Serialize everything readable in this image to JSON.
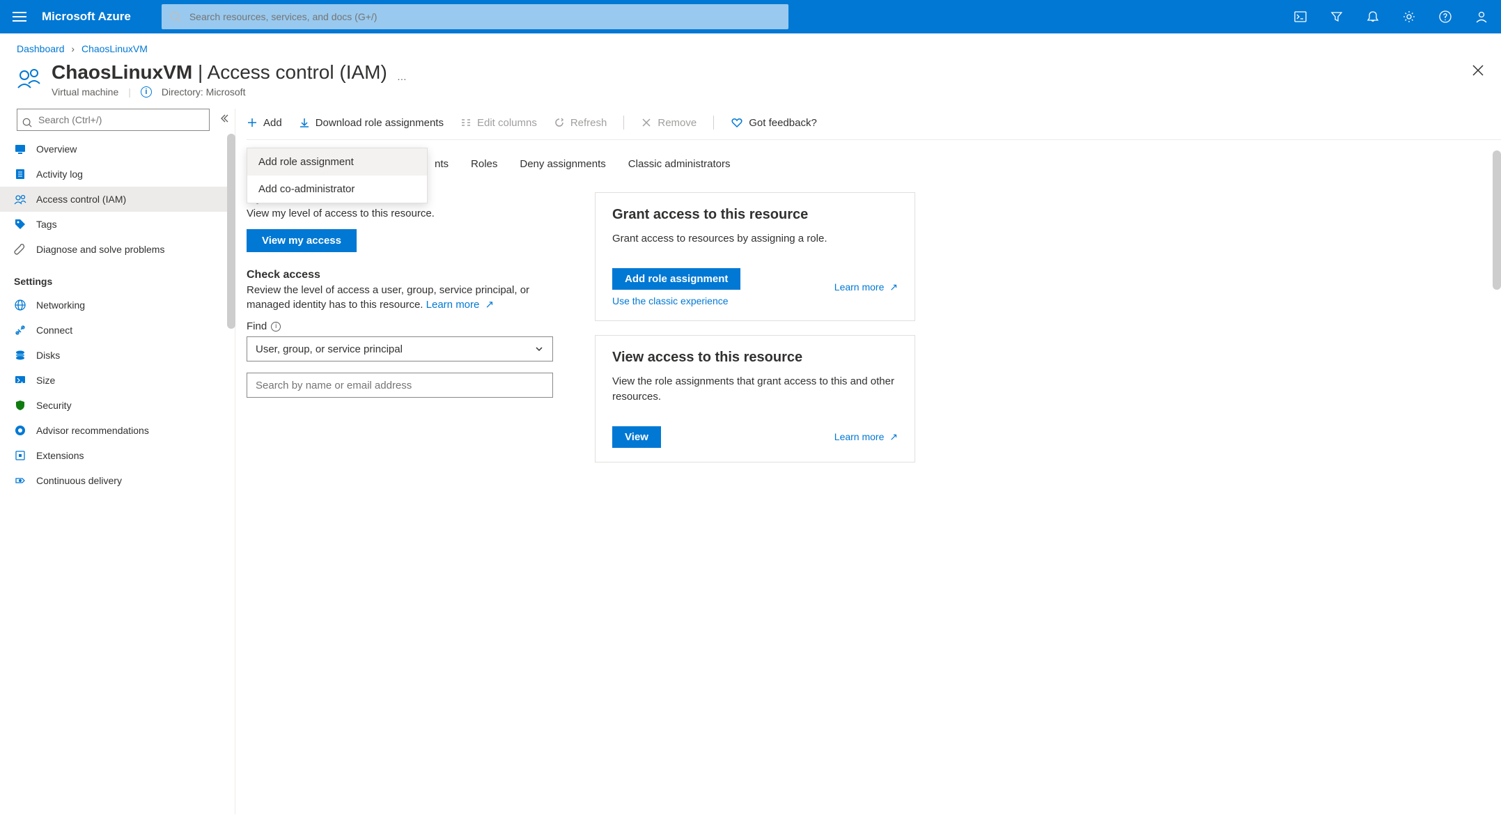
{
  "brand": "Microsoft Azure",
  "search_placeholder": "Search resources, services, and docs (G+/)",
  "breadcrumbs": {
    "root": "Dashboard",
    "current": "ChaosLinuxVM"
  },
  "header": {
    "title_main": "ChaosLinuxVM",
    "title_sub": "Access control (IAM)",
    "resource_type": "Virtual machine",
    "directory_label": "Directory: Microsoft",
    "ellipsis": "…"
  },
  "sidebar": {
    "search_placeholder": "Search (Ctrl+/)",
    "items_top": [
      {
        "label": "Overview",
        "icon": "monitor"
      },
      {
        "label": "Activity log",
        "icon": "log"
      },
      {
        "label": "Access control (IAM)",
        "icon": "people",
        "active": true
      },
      {
        "label": "Tags",
        "icon": "tag"
      },
      {
        "label": "Diagnose and solve problems",
        "icon": "wrench"
      }
    ],
    "section_label": "Settings",
    "items_settings": [
      {
        "label": "Networking",
        "icon": "globe"
      },
      {
        "label": "Connect",
        "icon": "plug"
      },
      {
        "label": "Disks",
        "icon": "disks"
      },
      {
        "label": "Size",
        "icon": "size"
      },
      {
        "label": "Security",
        "icon": "shield"
      },
      {
        "label": "Advisor recommendations",
        "icon": "advisor"
      },
      {
        "label": "Extensions",
        "icon": "ext"
      },
      {
        "label": "Continuous delivery",
        "icon": "cd"
      }
    ]
  },
  "toolbar": {
    "add": "Add",
    "download": "Download role assignments",
    "edit_columns": "Edit columns",
    "refresh": "Refresh",
    "remove": "Remove",
    "feedback": "Got feedback?"
  },
  "add_dropdown": {
    "item1": "Add role assignment",
    "item2": "Add co-administrator"
  },
  "tabs": {
    "t1_partial": "nts",
    "t2": "Roles",
    "t3": "Deny assignments",
    "t4": "Classic administrators"
  },
  "my_access": {
    "title": "My access",
    "desc": "View my level of access to this resource.",
    "button": "View my access"
  },
  "check_access": {
    "title": "Check access",
    "desc": "Review the level of access a user, group, service principal, or managed identity has to this resource. ",
    "learn_more": "Learn more",
    "find_label": "Find",
    "select_value": "User, group, or service principal",
    "search_placeholder": "Search by name or email address"
  },
  "card_grant": {
    "title": "Grant access to this resource",
    "desc": "Grant access to resources by assigning a role.",
    "button": "Add role assignment",
    "classic_link": "Use the classic experience",
    "learn_more": "Learn more"
  },
  "card_view": {
    "title": "View access to this resource",
    "desc": "View the role assignments that grant access to this and other resources.",
    "button": "View",
    "learn_more": "Learn more"
  }
}
